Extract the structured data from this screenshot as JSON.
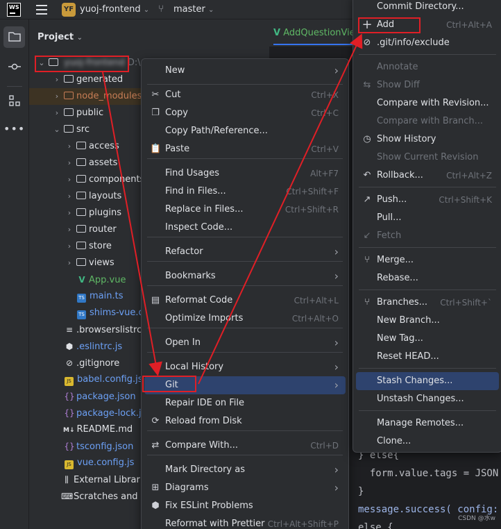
{
  "titlebar": {
    "logo": "WS",
    "project_badge": "YF",
    "project_name": "yuoj-frontend",
    "branch": "master"
  },
  "project_panel": {
    "title": "Project",
    "root_name": "yuoj-frontend",
    "root_path": "D:\\",
    "tree": [
      {
        "label": "generated",
        "type": "folder",
        "depth": 1,
        "expanded": false
      },
      {
        "label": "node_modules",
        "type": "folder-excluded",
        "depth": 1,
        "expanded": false
      },
      {
        "label": "public",
        "type": "folder",
        "depth": 1,
        "expanded": false
      },
      {
        "label": "src",
        "type": "folder",
        "depth": 1,
        "expanded": true
      },
      {
        "label": "access",
        "type": "folder",
        "depth": 2,
        "expanded": false
      },
      {
        "label": "assets",
        "type": "folder",
        "depth": 2,
        "expanded": false
      },
      {
        "label": "components",
        "type": "folder",
        "depth": 2,
        "expanded": false
      },
      {
        "label": "layouts",
        "type": "folder",
        "depth": 2,
        "expanded": false
      },
      {
        "label": "plugins",
        "type": "folder",
        "depth": 2,
        "expanded": false
      },
      {
        "label": "router",
        "type": "folder",
        "depth": 2,
        "expanded": false
      },
      {
        "label": "store",
        "type": "folder",
        "depth": 2,
        "expanded": false
      },
      {
        "label": "views",
        "type": "folder",
        "depth": 2,
        "expanded": false
      },
      {
        "label": "App.vue",
        "type": "vue",
        "depth": 2
      },
      {
        "label": "main.ts",
        "type": "ts",
        "depth": 2
      },
      {
        "label": "shims-vue.d.ts",
        "type": "ts",
        "depth": 2
      },
      {
        "label": ".browserslistrc",
        "type": "list",
        "depth": 1
      },
      {
        "label": ".eslintrc.js",
        "type": "eslint",
        "depth": 1
      },
      {
        "label": ".gitignore",
        "type": "ignore",
        "depth": 1
      },
      {
        "label": "babel.config.js",
        "type": "js",
        "depth": 1
      },
      {
        "label": "package.json",
        "type": "json",
        "depth": 1
      },
      {
        "label": "package-lock.json",
        "type": "json",
        "depth": 1
      },
      {
        "label": "README.md",
        "type": "md",
        "depth": 1
      },
      {
        "label": "tsconfig.json",
        "type": "json",
        "depth": 1
      },
      {
        "label": "vue.config.js",
        "type": "js",
        "depth": 1
      },
      {
        "label": "External Libraries",
        "type": "lib",
        "depth": 0
      },
      {
        "label": "Scratches and Consoles",
        "type": "scratch",
        "depth": 0
      }
    ]
  },
  "editor": {
    "tab_label": "AddQuestionView.vue",
    "code_lines": [
      "} else{",
      "  form.value.tags = JSON",
      "}",
      "message.success( config:",
      "else {"
    ]
  },
  "context_menu": {
    "items": [
      {
        "label": "New",
        "submenu": true
      },
      {
        "sep": true
      },
      {
        "label": "Cut",
        "icon": "scissors-icon",
        "shortcut": "Ctrl+X"
      },
      {
        "label": "Copy",
        "icon": "copy-icon",
        "shortcut": "Ctrl+C"
      },
      {
        "label": "Copy Path/Reference..."
      },
      {
        "label": "Paste",
        "icon": "paste-icon",
        "shortcut": "Ctrl+V"
      },
      {
        "sep": true
      },
      {
        "label": "Find Usages",
        "shortcut": "Alt+F7"
      },
      {
        "label": "Find in Files...",
        "shortcut": "Ctrl+Shift+F"
      },
      {
        "label": "Replace in Files...",
        "shortcut": "Ctrl+Shift+R"
      },
      {
        "label": "Inspect Code..."
      },
      {
        "sep": true
      },
      {
        "label": "Refactor",
        "submenu": true
      },
      {
        "sep": true
      },
      {
        "label": "Bookmarks",
        "submenu": true
      },
      {
        "sep": true
      },
      {
        "label": "Reformat Code",
        "icon": "reformat-icon",
        "shortcut": "Ctrl+Alt+L"
      },
      {
        "label": "Optimize Imports",
        "shortcut": "Ctrl+Alt+O"
      },
      {
        "sep": true
      },
      {
        "label": "Open In",
        "submenu": true
      },
      {
        "sep": true
      },
      {
        "label": "Local History",
        "submenu": true
      },
      {
        "label": "Git",
        "submenu": true,
        "active": true
      },
      {
        "label": "Repair IDE on File"
      },
      {
        "label": "Reload from Disk",
        "icon": "reload-icon"
      },
      {
        "sep": true
      },
      {
        "label": "Compare With...",
        "icon": "compare-icon",
        "shortcut": "Ctrl+D"
      },
      {
        "sep": true
      },
      {
        "label": "Mark Directory as",
        "submenu": true
      },
      {
        "label": "Diagrams",
        "icon": "diagram-icon",
        "submenu": true
      },
      {
        "label": "Fix ESLint Problems",
        "icon": "eslint-icon"
      },
      {
        "label": "Reformat with Prettier",
        "shortcut": "Ctrl+Alt+Shift+P"
      }
    ]
  },
  "git_menu": {
    "items": [
      {
        "label": "Commit Directory..."
      },
      {
        "label": "Add",
        "icon": "plus-icon",
        "shortcut": "Ctrl+Alt+A"
      },
      {
        "label": ".git/info/exclude",
        "icon": "ignore-icon"
      },
      {
        "sep": true
      },
      {
        "label": "Annotate",
        "disabled": true
      },
      {
        "label": "Show Diff",
        "icon": "diff-icon",
        "disabled": true
      },
      {
        "label": "Compare with Revision..."
      },
      {
        "label": "Compare with Branch...",
        "disabled": true
      },
      {
        "label": "Show History",
        "icon": "history-icon"
      },
      {
        "label": "Show Current Revision",
        "disabled": true
      },
      {
        "label": "Rollback...",
        "icon": "rollback-icon",
        "shortcut": "Ctrl+Alt+Z"
      },
      {
        "sep": true
      },
      {
        "label": "Push...",
        "icon": "push-icon",
        "shortcut": "Ctrl+Shift+K"
      },
      {
        "label": "Pull..."
      },
      {
        "label": "Fetch",
        "icon": "fetch-icon",
        "disabled": true
      },
      {
        "sep": true
      },
      {
        "label": "Merge...",
        "icon": "merge-icon"
      },
      {
        "label": "Rebase..."
      },
      {
        "sep": true
      },
      {
        "label": "Branches...",
        "icon": "branch-icon",
        "shortcut": "Ctrl+Shift+`"
      },
      {
        "label": "New Branch..."
      },
      {
        "label": "New Tag..."
      },
      {
        "label": "Reset HEAD..."
      },
      {
        "sep": true
      },
      {
        "label": "Stash Changes...",
        "active": true
      },
      {
        "label": "Unstash Changes..."
      },
      {
        "sep": true
      },
      {
        "label": "Manage Remotes..."
      },
      {
        "label": "Clone..."
      }
    ]
  },
  "watermark": "CSDN @水w",
  "colors": {
    "accent": "#3574f0",
    "annotation_red": "#e01f26",
    "selection": "#2e436e"
  }
}
